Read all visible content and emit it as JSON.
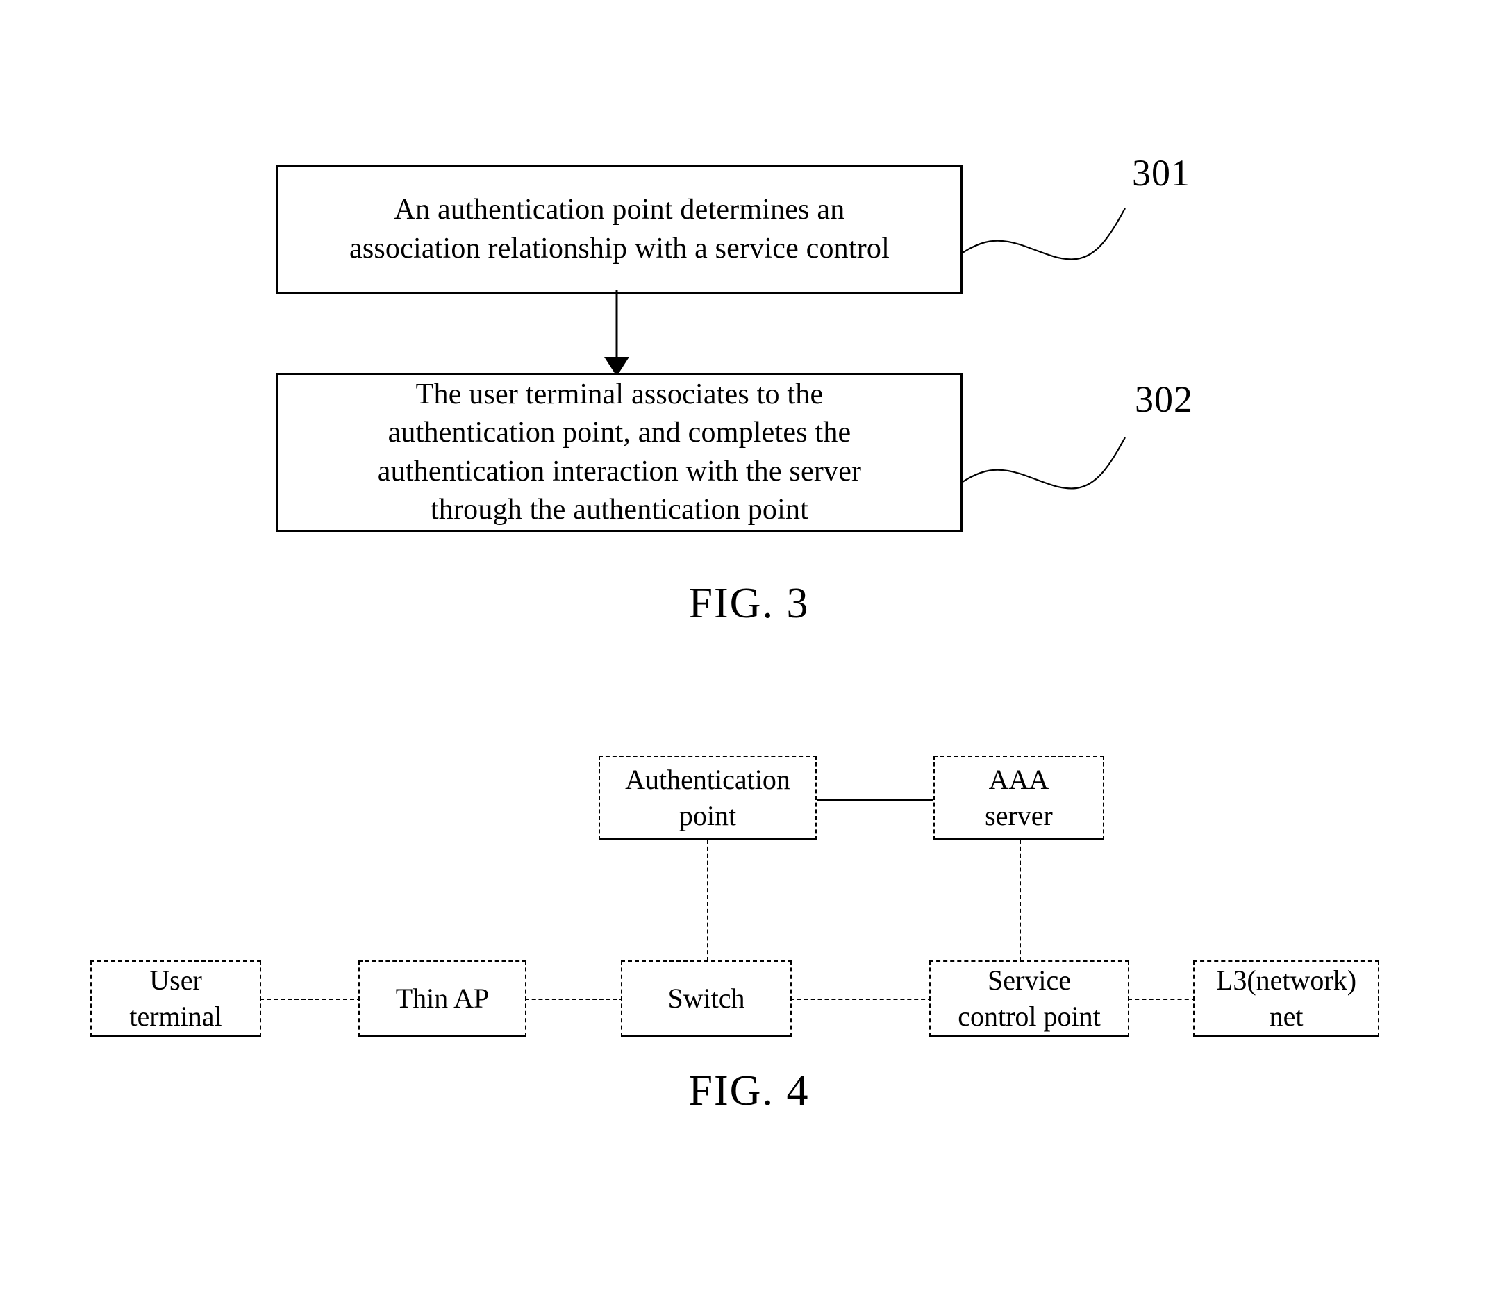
{
  "figures": [
    {
      "id": "fig3",
      "caption": "FIG. 3",
      "steps": [
        {
          "ref": "301",
          "text": "An authentication point determines an\nassociation relationship with a service control"
        },
        {
          "ref": "302",
          "text": "The user terminal associates to the\nauthentication point, and completes the\nauthentication interaction with the server\nthrough the authentication point"
        }
      ]
    },
    {
      "id": "fig4",
      "caption": "FIG. 4",
      "nodes": {
        "auth_point": "Authentication\npoint",
        "aaa_server": "AAA\nserver",
        "user_terminal": "User\nterminal",
        "thin_ap": "Thin AP",
        "switch": "Switch",
        "service_control_point": "Service\ncontrol point",
        "l3_net": "L3(network)\nnet"
      }
    }
  ],
  "colors": {
    "line": "#000000",
    "background": "#ffffff",
    "text": "#000000"
  }
}
